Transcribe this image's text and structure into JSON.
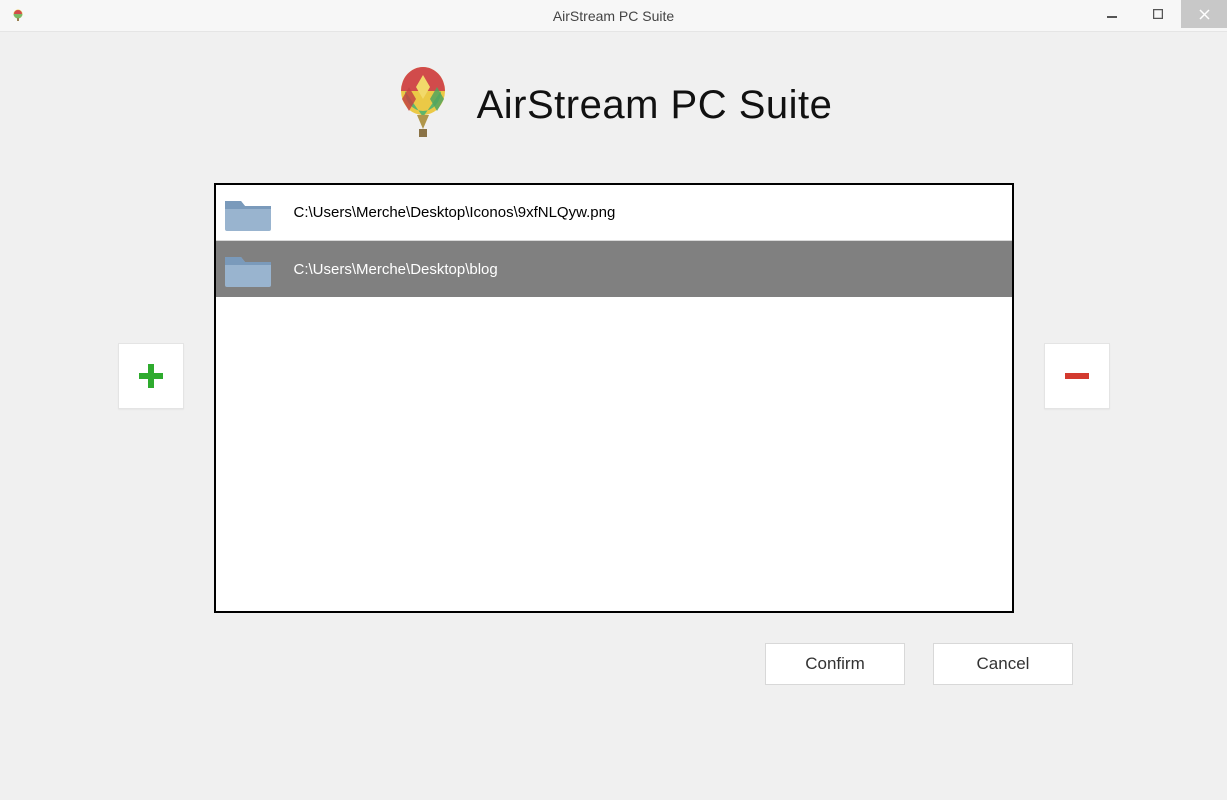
{
  "window": {
    "title": "AirStream PC Suite"
  },
  "header": {
    "title": "AirStream PC Suite"
  },
  "files": [
    {
      "path": "C:\\Users\\Merche\\Desktop\\Iconos\\9xfNLQyw.png",
      "selected": false
    },
    {
      "path": "C:\\Users\\Merche\\Desktop\\blog",
      "selected": true
    }
  ],
  "buttons": {
    "confirm": "Confirm",
    "cancel": "Cancel"
  }
}
